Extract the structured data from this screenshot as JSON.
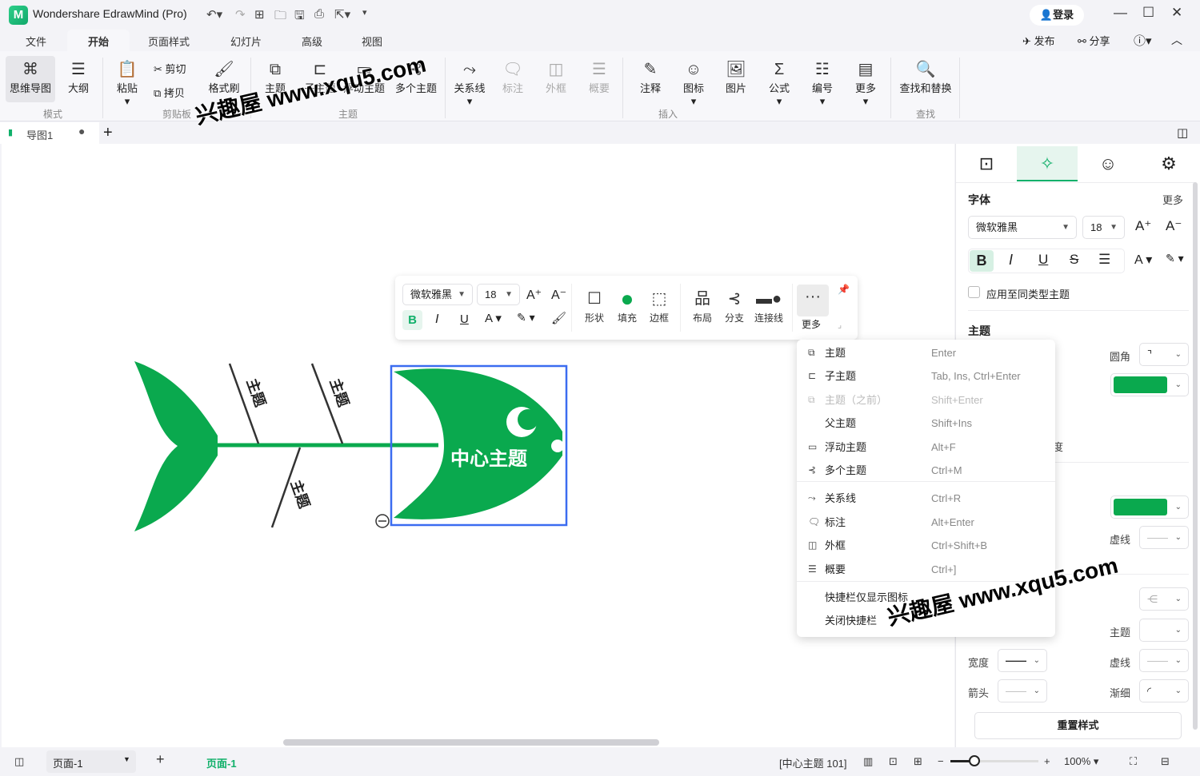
{
  "app": {
    "title": "Wondershare EdrawMind (Pro)",
    "login": "登录",
    "publish": "发布",
    "share": "分享"
  },
  "menu_tabs": [
    "文件",
    "开始",
    "页面样式",
    "幻灯片",
    "高级",
    "视图"
  ],
  "ribbon": {
    "mode": {
      "label": "模式",
      "items": [
        "思维导图",
        "大纲"
      ]
    },
    "clipboard": {
      "label": "剪贴板",
      "paste": "粘贴",
      "cut": "剪切",
      "copy": "拷贝",
      "format_painter": "格式刷"
    },
    "topic": {
      "label": "主题",
      "items": [
        "主题",
        "子主题",
        "浮动主题",
        "多个主题"
      ]
    },
    "misc": [
      "关系线",
      "标注",
      "外框",
      "概要"
    ],
    "insert": {
      "label": "插入",
      "items": [
        "注释",
        "图标",
        "图片",
        "公式",
        "编号",
        "更多"
      ]
    },
    "find": {
      "label": "查找",
      "items": [
        "查找和替换"
      ]
    }
  },
  "doc_tab": {
    "name": "导图1"
  },
  "canvas": {
    "central_topic": "中心主题",
    "branches": [
      "主题",
      "主题",
      "主题"
    ]
  },
  "floatbar": {
    "font": "微软雅黑",
    "size": "18",
    "items": [
      "形状",
      "填充",
      "边框",
      "布局",
      "分支",
      "连接线",
      "更多"
    ]
  },
  "context_menu": [
    {
      "label": "主题",
      "shortcut": "Enter",
      "icon": "topic-icon"
    },
    {
      "label": "子主题",
      "shortcut": "Tab, Ins, Ctrl+Enter",
      "icon": "subtopic-icon"
    },
    {
      "label": "主题（之前）",
      "shortcut": "Shift+Enter",
      "icon": "topic-before-icon",
      "disabled": true
    },
    {
      "label": "父主题",
      "shortcut": "Shift+Ins"
    },
    {
      "label": "浮动主题",
      "shortcut": "Alt+F",
      "icon": "floating-topic-icon"
    },
    {
      "label": "多个主题",
      "shortcut": "Ctrl+M",
      "icon": "multiple-topics-icon"
    },
    {
      "label": "关系线",
      "shortcut": "Ctrl+R",
      "icon": "relationship-icon"
    },
    {
      "label": "标注",
      "shortcut": "Alt+Enter",
      "icon": "callout-icon"
    },
    {
      "label": "外框",
      "shortcut": "Ctrl+Shift+B",
      "icon": "boundary-icon"
    },
    {
      "label": "概要",
      "shortcut": "Ctrl+]",
      "icon": "summary-icon"
    },
    {
      "label": "快捷栏仅显示图标"
    },
    {
      "label": "关闭快捷栏"
    }
  ],
  "panel": {
    "font_header": "字体",
    "more": "更多",
    "font": "微软雅黑",
    "size": "18",
    "apply_same": "应用至同类型主题",
    "topic_header": "主题",
    "corner": "圆角",
    "dash": "虚线",
    "topic": "主题",
    "width": "宽度",
    "dash2": "虚线",
    "arrow": "箭头",
    "taper": "渐细",
    "partial": "度",
    "reset": "重置样式",
    "fill_color": "#0aa94e"
  },
  "status": {
    "page_select": "页面-1",
    "page_tab": "页面-1",
    "selection": "[中心主题 101]",
    "zoom": "100%",
    "zoom_level": 0.5
  },
  "watermark": "兴趣屋 www.xqu5.com",
  "colors": {
    "accent": "#10b06a",
    "fish": "#0aa94e",
    "selection": "#3b6cf0"
  }
}
